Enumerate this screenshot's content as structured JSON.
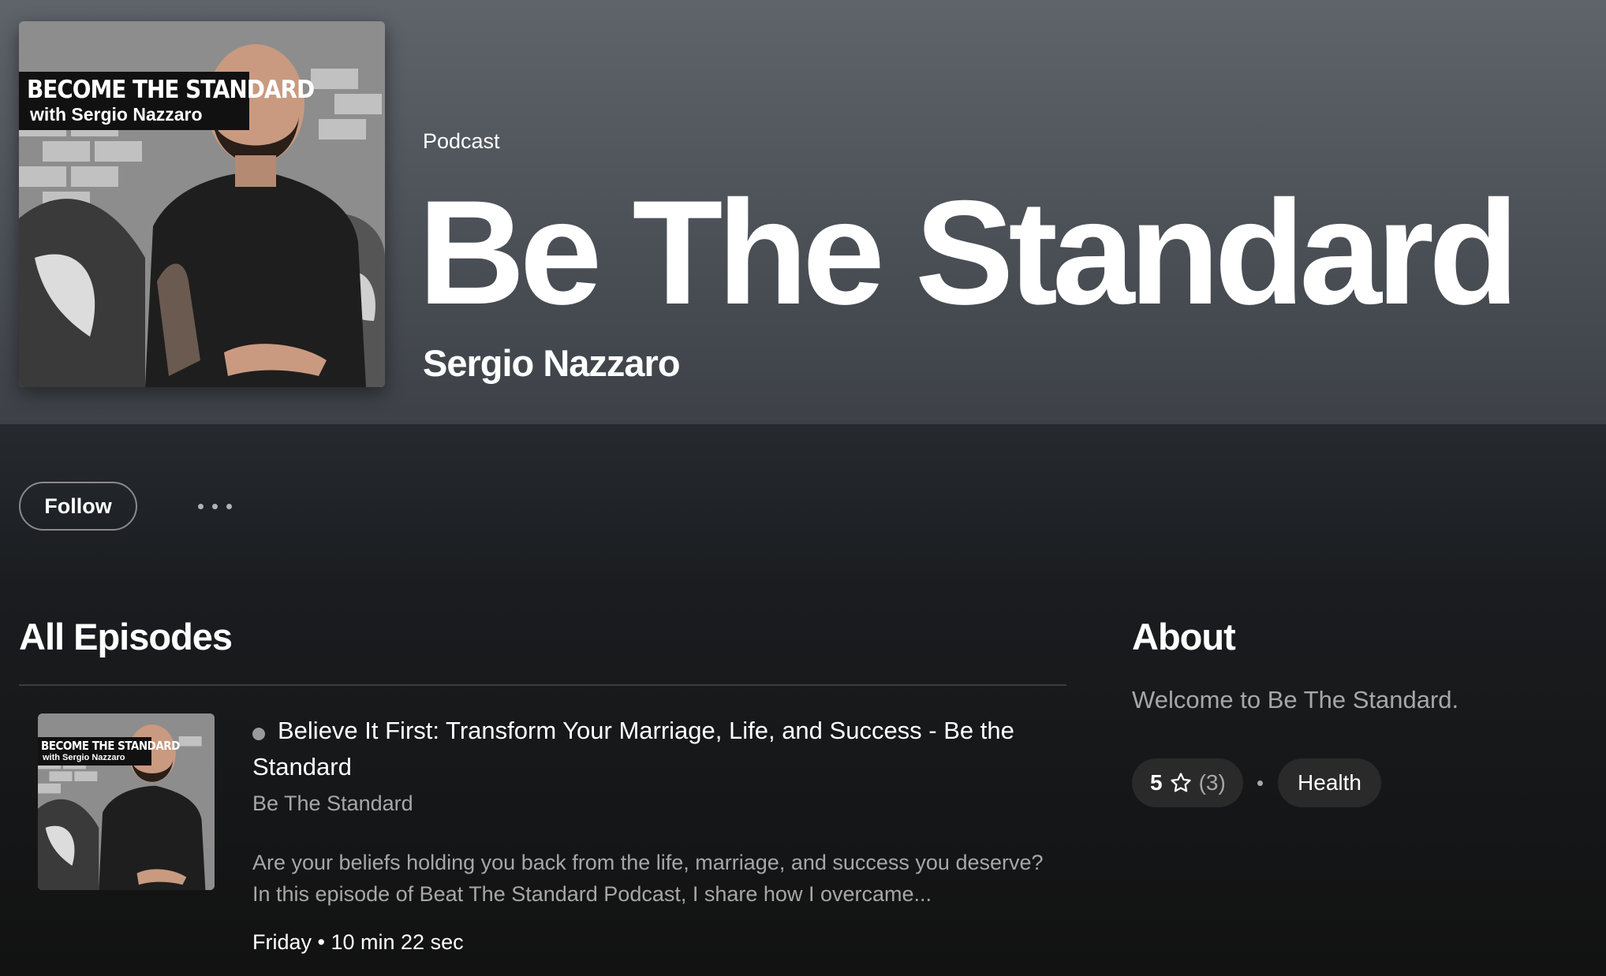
{
  "show": {
    "type_label": "Podcast",
    "title": "Be The Standard",
    "author": "Sergio Nazzaro",
    "cover": {
      "line1": "BECOME THE STANDARD",
      "line2": "with Sergio Nazzaro"
    }
  },
  "actions": {
    "follow_label": "Follow",
    "more_icon": "more-horizontal-icon"
  },
  "episodes": {
    "heading": "All Episodes",
    "items": [
      {
        "title": "Believe It First: Transform Your Marriage, Life, and Success - Be the Standard",
        "show": "Be The Standard",
        "description": "Are your beliefs holding you back from the life, marriage, and success you deserve? In this episode of Beat The Standard Podcast, I share how I overcame...",
        "date": "Friday",
        "duration": "10 min 22 sec"
      }
    ]
  },
  "about": {
    "heading": "About",
    "text": "Welcome to Be The Standard.",
    "rating": {
      "value": "5",
      "count": "(3)",
      "icon": "star-outline-icon"
    },
    "category": "Health"
  },
  "colors": {
    "header_top": "#5f646b",
    "background": "#121212",
    "secondary_text": "#a7a7a7",
    "pill_bg": "#2a2a2a"
  }
}
